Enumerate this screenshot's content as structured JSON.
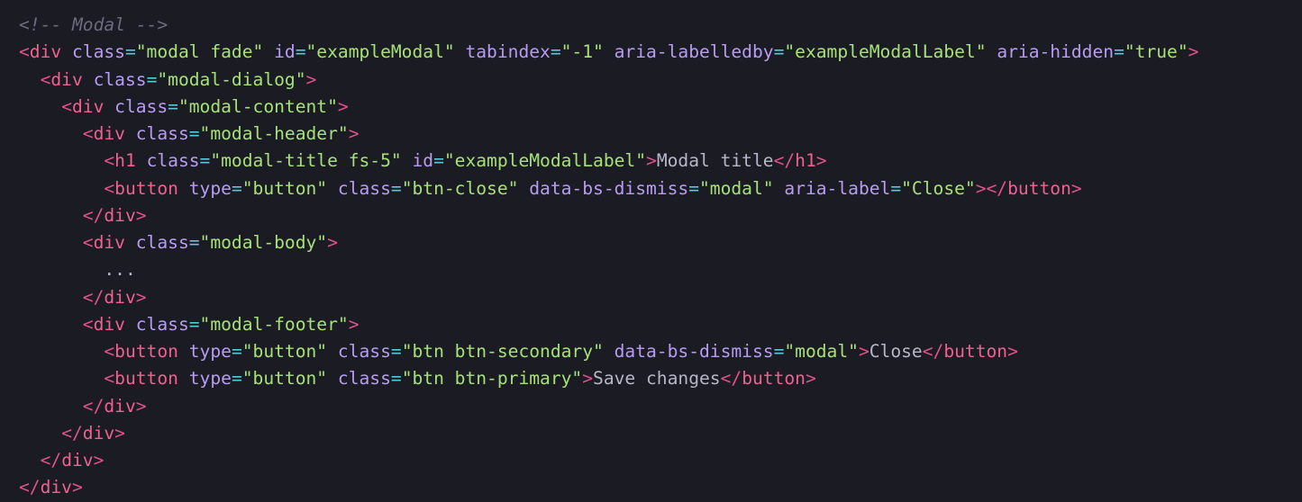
{
  "colors": {
    "background": "#1b1b24",
    "comment": "#6b6b80",
    "tag_punctuation": "#e0528a",
    "tag_name": "#f0618f",
    "attribute_name": "#b79cf2",
    "operator": "#5ac8dc",
    "string": "#a6e178",
    "text": "#b6b6c8"
  },
  "lines": [
    [
      {
        "t": "<!-- Modal -->",
        "c": "comment"
      }
    ],
    [
      {
        "t": "<",
        "c": "punct"
      },
      {
        "t": "div",
        "c": "tag"
      },
      {
        "t": " "
      },
      {
        "t": "class",
        "c": "attr"
      },
      {
        "t": "=",
        "c": "op"
      },
      {
        "t": "\"modal fade\"",
        "c": "string"
      },
      {
        "t": " "
      },
      {
        "t": "id",
        "c": "attr"
      },
      {
        "t": "=",
        "c": "op"
      },
      {
        "t": "\"exampleModal\"",
        "c": "string"
      },
      {
        "t": " "
      },
      {
        "t": "tabindex",
        "c": "attr"
      },
      {
        "t": "=",
        "c": "op"
      },
      {
        "t": "\"-1\"",
        "c": "string"
      },
      {
        "t": " "
      },
      {
        "t": "aria-labelledby",
        "c": "attr"
      },
      {
        "t": "=",
        "c": "op"
      },
      {
        "t": "\"exampleModalLabel\"",
        "c": "string"
      },
      {
        "t": " "
      },
      {
        "t": "aria-hidden",
        "c": "attr"
      },
      {
        "t": "=",
        "c": "op"
      },
      {
        "t": "\"true\"",
        "c": "string"
      },
      {
        "t": ">",
        "c": "punct"
      }
    ],
    [
      {
        "t": "  "
      },
      {
        "t": "<",
        "c": "punct"
      },
      {
        "t": "div",
        "c": "tag"
      },
      {
        "t": " "
      },
      {
        "t": "class",
        "c": "attr"
      },
      {
        "t": "=",
        "c": "op"
      },
      {
        "t": "\"modal-dialog\"",
        "c": "string"
      },
      {
        "t": ">",
        "c": "punct"
      }
    ],
    [
      {
        "t": "    "
      },
      {
        "t": "<",
        "c": "punct"
      },
      {
        "t": "div",
        "c": "tag"
      },
      {
        "t": " "
      },
      {
        "t": "class",
        "c": "attr"
      },
      {
        "t": "=",
        "c": "op"
      },
      {
        "t": "\"modal-content\"",
        "c": "string"
      },
      {
        "t": ">",
        "c": "punct"
      }
    ],
    [
      {
        "t": "      "
      },
      {
        "t": "<",
        "c": "punct"
      },
      {
        "t": "div",
        "c": "tag"
      },
      {
        "t": " "
      },
      {
        "t": "class",
        "c": "attr"
      },
      {
        "t": "=",
        "c": "op"
      },
      {
        "t": "\"modal-header\"",
        "c": "string"
      },
      {
        "t": ">",
        "c": "punct"
      }
    ],
    [
      {
        "t": "        "
      },
      {
        "t": "<",
        "c": "punct"
      },
      {
        "t": "h1",
        "c": "tag"
      },
      {
        "t": " "
      },
      {
        "t": "class",
        "c": "attr"
      },
      {
        "t": "=",
        "c": "op"
      },
      {
        "t": "\"modal-title fs-5\"",
        "c": "string"
      },
      {
        "t": " "
      },
      {
        "t": "id",
        "c": "attr"
      },
      {
        "t": "=",
        "c": "op"
      },
      {
        "t": "\"exampleModalLabel\"",
        "c": "string"
      },
      {
        "t": ">",
        "c": "punct"
      },
      {
        "t": "Modal title",
        "c": "text"
      },
      {
        "t": "</",
        "c": "punct"
      },
      {
        "t": "h1",
        "c": "tag"
      },
      {
        "t": ">",
        "c": "punct"
      }
    ],
    [
      {
        "t": "        "
      },
      {
        "t": "<",
        "c": "punct"
      },
      {
        "t": "button",
        "c": "tag"
      },
      {
        "t": " "
      },
      {
        "t": "type",
        "c": "attr"
      },
      {
        "t": "=",
        "c": "op"
      },
      {
        "t": "\"button\"",
        "c": "string"
      },
      {
        "t": " "
      },
      {
        "t": "class",
        "c": "attr"
      },
      {
        "t": "=",
        "c": "op"
      },
      {
        "t": "\"btn-close\"",
        "c": "string"
      },
      {
        "t": " "
      },
      {
        "t": "data-bs-dismiss",
        "c": "attr"
      },
      {
        "t": "=",
        "c": "op"
      },
      {
        "t": "\"modal\"",
        "c": "string"
      },
      {
        "t": " "
      },
      {
        "t": "aria-label",
        "c": "attr"
      },
      {
        "t": "=",
        "c": "op"
      },
      {
        "t": "\"Close\"",
        "c": "string"
      },
      {
        "t": ">",
        "c": "punct"
      },
      {
        "t": "</",
        "c": "punct"
      },
      {
        "t": "button",
        "c": "tag"
      },
      {
        "t": ">",
        "c": "punct"
      }
    ],
    [
      {
        "t": "      "
      },
      {
        "t": "</",
        "c": "punct"
      },
      {
        "t": "div",
        "c": "tag"
      },
      {
        "t": ">",
        "c": "punct"
      }
    ],
    [
      {
        "t": "      "
      },
      {
        "t": "<",
        "c": "punct"
      },
      {
        "t": "div",
        "c": "tag"
      },
      {
        "t": " "
      },
      {
        "t": "class",
        "c": "attr"
      },
      {
        "t": "=",
        "c": "op"
      },
      {
        "t": "\"modal-body\"",
        "c": "string"
      },
      {
        "t": ">",
        "c": "punct"
      }
    ],
    [
      {
        "t": "        "
      },
      {
        "t": "...",
        "c": "text"
      }
    ],
    [
      {
        "t": "      "
      },
      {
        "t": "</",
        "c": "punct"
      },
      {
        "t": "div",
        "c": "tag"
      },
      {
        "t": ">",
        "c": "punct"
      }
    ],
    [
      {
        "t": "      "
      },
      {
        "t": "<",
        "c": "punct"
      },
      {
        "t": "div",
        "c": "tag"
      },
      {
        "t": " "
      },
      {
        "t": "class",
        "c": "attr"
      },
      {
        "t": "=",
        "c": "op"
      },
      {
        "t": "\"modal-footer\"",
        "c": "string"
      },
      {
        "t": ">",
        "c": "punct"
      }
    ],
    [
      {
        "t": "        "
      },
      {
        "t": "<",
        "c": "punct"
      },
      {
        "t": "button",
        "c": "tag"
      },
      {
        "t": " "
      },
      {
        "t": "type",
        "c": "attr"
      },
      {
        "t": "=",
        "c": "op"
      },
      {
        "t": "\"button\"",
        "c": "string"
      },
      {
        "t": " "
      },
      {
        "t": "class",
        "c": "attr"
      },
      {
        "t": "=",
        "c": "op"
      },
      {
        "t": "\"btn btn-secondary\"",
        "c": "string"
      },
      {
        "t": " "
      },
      {
        "t": "data-bs-dismiss",
        "c": "attr"
      },
      {
        "t": "=",
        "c": "op"
      },
      {
        "t": "\"modal\"",
        "c": "string"
      },
      {
        "t": ">",
        "c": "punct"
      },
      {
        "t": "Close",
        "c": "text"
      },
      {
        "t": "</",
        "c": "punct"
      },
      {
        "t": "button",
        "c": "tag"
      },
      {
        "t": ">",
        "c": "punct"
      }
    ],
    [
      {
        "t": "        "
      },
      {
        "t": "<",
        "c": "punct"
      },
      {
        "t": "button",
        "c": "tag"
      },
      {
        "t": " "
      },
      {
        "t": "type",
        "c": "attr"
      },
      {
        "t": "=",
        "c": "op"
      },
      {
        "t": "\"button\"",
        "c": "string"
      },
      {
        "t": " "
      },
      {
        "t": "class",
        "c": "attr"
      },
      {
        "t": "=",
        "c": "op"
      },
      {
        "t": "\"btn btn-primary\"",
        "c": "string"
      },
      {
        "t": ">",
        "c": "punct"
      },
      {
        "t": "Save changes",
        "c": "text"
      },
      {
        "t": "</",
        "c": "punct"
      },
      {
        "t": "button",
        "c": "tag"
      },
      {
        "t": ">",
        "c": "punct"
      }
    ],
    [
      {
        "t": "      "
      },
      {
        "t": "</",
        "c": "punct"
      },
      {
        "t": "div",
        "c": "tag"
      },
      {
        "t": ">",
        "c": "punct"
      }
    ],
    [
      {
        "t": "    "
      },
      {
        "t": "</",
        "c": "punct"
      },
      {
        "t": "div",
        "c": "tag"
      },
      {
        "t": ">",
        "c": "punct"
      }
    ],
    [
      {
        "t": "  "
      },
      {
        "t": "</",
        "c": "punct"
      },
      {
        "t": "div",
        "c": "tag"
      },
      {
        "t": ">",
        "c": "punct"
      }
    ],
    [
      {
        "t": "</",
        "c": "punct"
      },
      {
        "t": "div",
        "c": "tag"
      },
      {
        "t": ">",
        "c": "punct"
      }
    ]
  ]
}
